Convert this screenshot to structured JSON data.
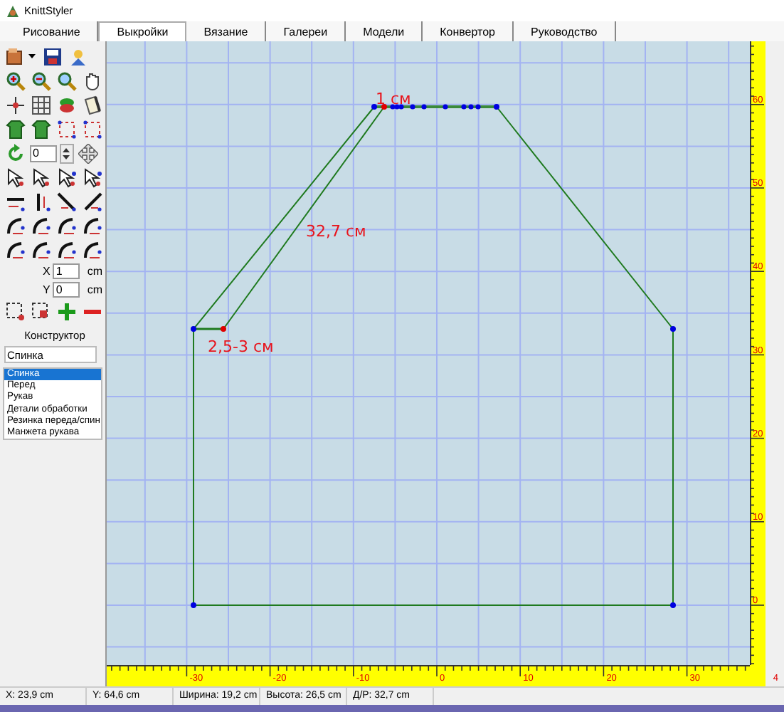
{
  "window": {
    "title": "KnittStyler"
  },
  "tabs": [
    {
      "label": "Рисование",
      "selected": false
    },
    {
      "label": "Выкройки",
      "selected": true
    },
    {
      "label": "Вязание",
      "selected": false
    },
    {
      "label": "Галереи",
      "selected": false
    },
    {
      "label": "Модели",
      "selected": false
    },
    {
      "label": "Конвертор",
      "selected": false
    },
    {
      "label": "Руководство",
      "selected": false
    }
  ],
  "toolbar": {
    "angle_value": "0",
    "x_label": "X",
    "x_value": "1",
    "x_unit": "cm",
    "y_label": "Y",
    "y_value": "0",
    "y_unit": "cm"
  },
  "constructor": {
    "title": "Конструктор",
    "name_value": "Спинка",
    "pieces": [
      {
        "label": "Спинка",
        "selected": true
      },
      {
        "label": "Перед",
        "selected": false
      },
      {
        "label": "Рукав",
        "selected": false
      },
      {
        "label": "Детали обработки",
        "selected": false
      },
      {
        "label": "Резинка переда/спин",
        "selected": false
      },
      {
        "label": "Манжета рукава",
        "selected": false
      }
    ]
  },
  "canvas": {
    "annotations": [
      {
        "text": "1 см"
      },
      {
        "text": "32,7 см"
      },
      {
        "text": "2,5-3 см"
      }
    ],
    "x_ruler": [
      "-30",
      "-20",
      "-10",
      "0",
      "10",
      "20",
      "30",
      "4"
    ],
    "y_ruler": [
      "60",
      "50",
      "40",
      "30",
      "20",
      "10",
      "0"
    ]
  },
  "status_bar": [
    "X: 23,9 cm",
    "Y: 64,6 cm",
    "Ширина: 19,2 cm",
    "Высота: 26,5 cm",
    "Д/Р: 32,7 cm"
  ]
}
